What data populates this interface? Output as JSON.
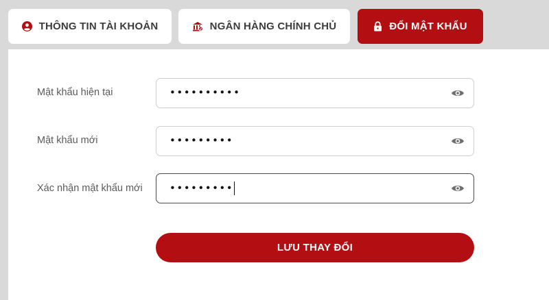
{
  "tabs": {
    "account_info": {
      "label": "THÔNG TIN TÀI KHOẢN",
      "icon": "user-circle-icon"
    },
    "bank_account": {
      "label": "NGÂN HÀNG CHÍNH CHỦ",
      "icon": "bank-icon"
    },
    "change_password": {
      "label": "ĐỔI MẬT KHẨU",
      "icon": "lock-icon"
    }
  },
  "form": {
    "current_password": {
      "label": "Mật khẩu hiện tại",
      "value": "••••••••••"
    },
    "new_password": {
      "label": "Mật khẩu mới",
      "value": "•••••••••"
    },
    "confirm_password": {
      "label": "Xác nhận mật khẩu mới",
      "value": "•••••••••"
    },
    "save_label": "LƯU THAY ĐỔI"
  },
  "colors": {
    "accent": "#b30f12",
    "background": "#d9d9d9",
    "panel": "#ffffff"
  }
}
